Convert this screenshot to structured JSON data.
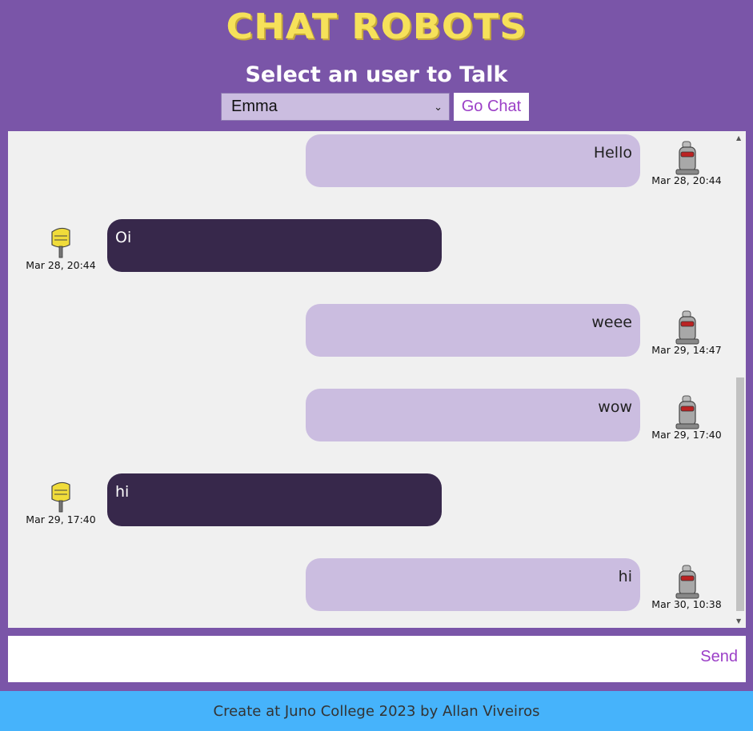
{
  "header": {
    "logo": "CHAT ROBOTS",
    "subtitle": "Select an user to Talk",
    "user_select_value": "Emma",
    "go_label": "Go Chat"
  },
  "messages": [
    {
      "side": "out",
      "text": "Hello",
      "time": "Mar 28, 20:44",
      "avatar": "robot-icon"
    },
    {
      "side": "in",
      "text": "Oi",
      "time": "Mar 28, 20:44",
      "avatar": "yellow-robot-icon"
    },
    {
      "side": "out",
      "text": "weee",
      "time": "Mar 29, 14:47",
      "avatar": "robot-icon"
    },
    {
      "side": "out",
      "text": "wow",
      "time": "Mar 29, 17:40",
      "avatar": "robot-icon"
    },
    {
      "side": "in",
      "text": "hi",
      "time": "Mar 29, 17:40",
      "avatar": "yellow-robot-icon"
    },
    {
      "side": "out",
      "text": "hi",
      "time": "Mar 30, 10:38",
      "avatar": "robot-icon"
    }
  ],
  "composer": {
    "send_label": "Send"
  },
  "footer": {
    "text": "Create at Juno College 2023 by Allan Viveiros"
  },
  "colors": {
    "background": "#7a55a8",
    "logo": "#f6e15a",
    "outgoing_bubble": "#cbbde0",
    "incoming_bubble": "#37284b",
    "accent": "#9b3fc7",
    "footer": "#46b3fb"
  }
}
